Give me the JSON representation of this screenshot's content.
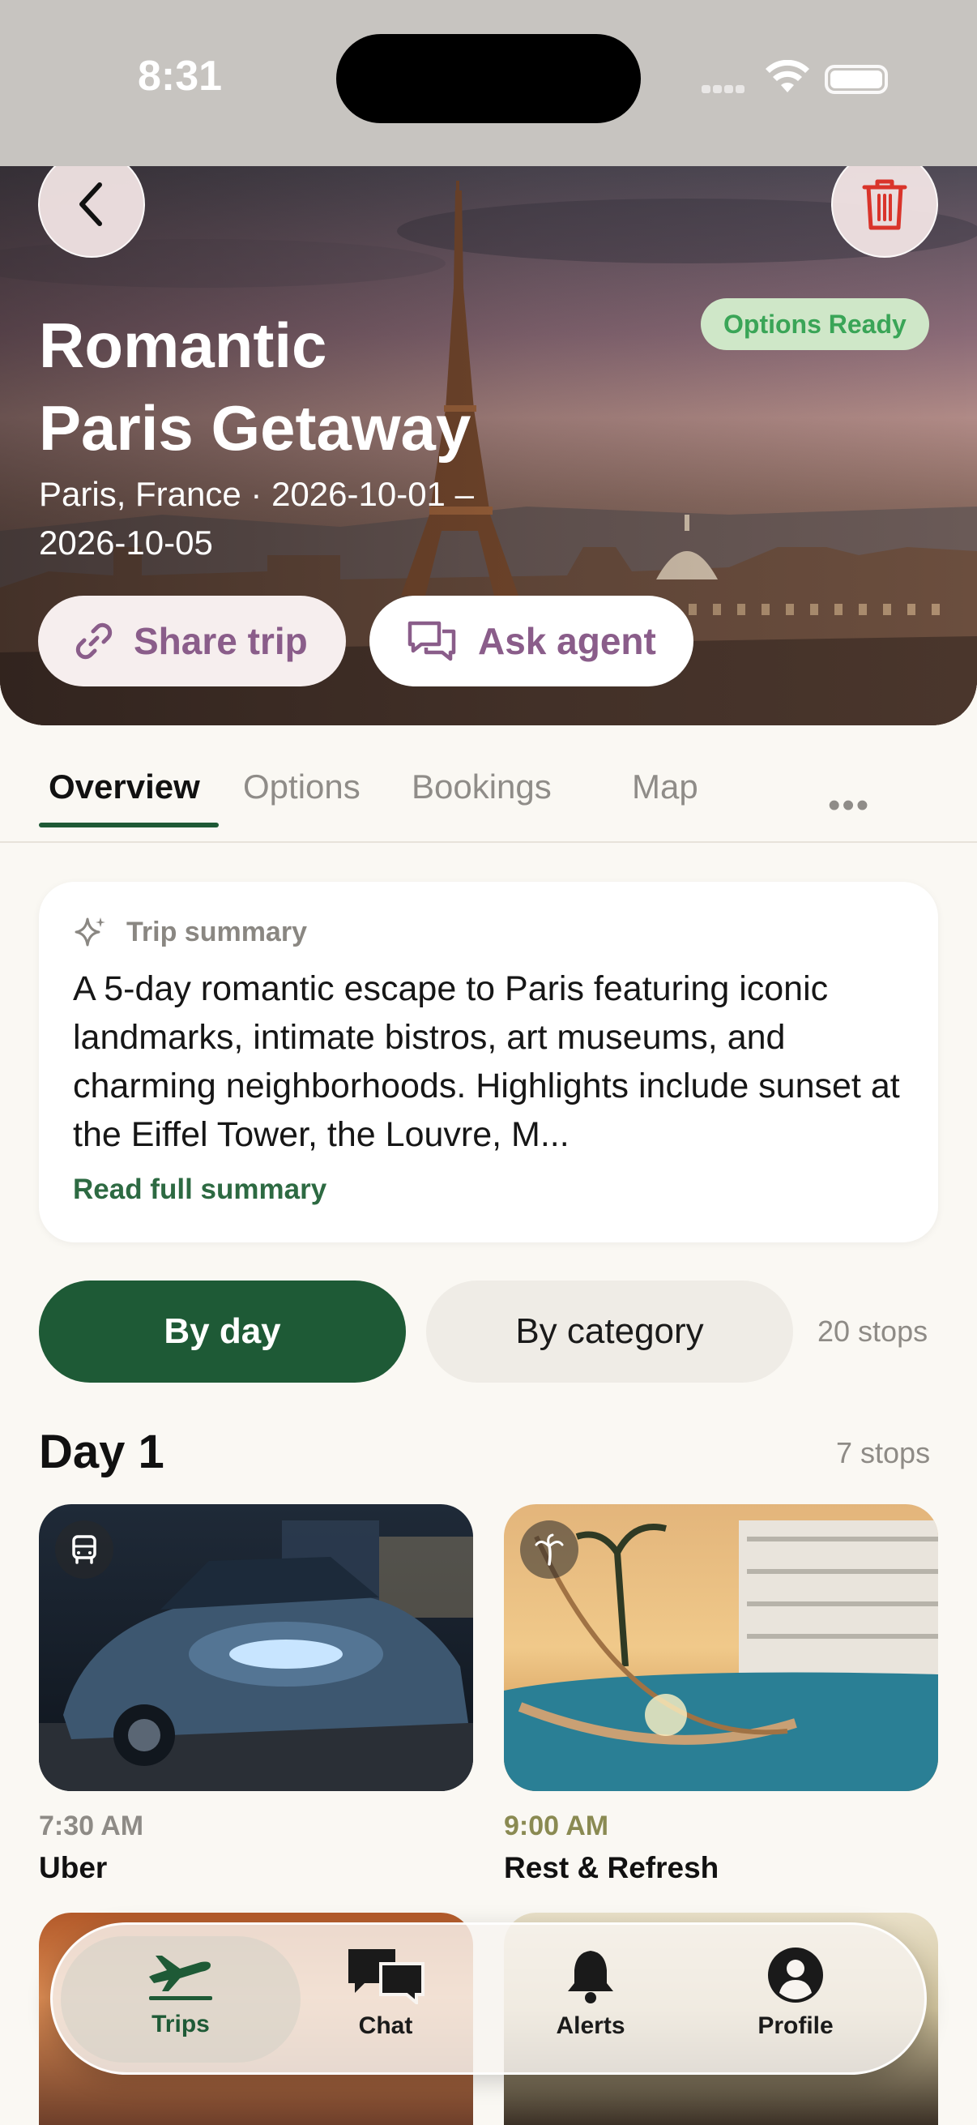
{
  "status_bar": {
    "time": "8:31"
  },
  "trip": {
    "title_line1": "Romantic",
    "title_line2": "Paris Getaway",
    "subtitle_line1": "Paris, France · 2026-10-01 –",
    "subtitle_line2": "2026-10-05",
    "status": "Options Ready"
  },
  "actions": {
    "share": "Share trip",
    "ask": "Ask agent"
  },
  "tabs": [
    "Overview",
    "Options",
    "Bookings",
    "Map"
  ],
  "summary": {
    "heading": "Trip summary",
    "text": "A 5-day romantic escape to Paris featuring iconic landmarks, intimate bistros, art museums, and charming neighborhoods. Highlights include sunset at the Eiffel Tower, the Louvre, M...",
    "read_more": "Read full summary"
  },
  "grouping": {
    "by_day": "By day",
    "by_category": "By category",
    "stops_total": "20 stops"
  },
  "day": {
    "title": "Day 1",
    "stops": "7 stops",
    "items": [
      {
        "time": "7:30 AM",
        "title": "Uber",
        "icon": "bus-icon",
        "time_color": "#8e8b86"
      },
      {
        "time": "9:00 AM",
        "title": "Rest & Refresh",
        "icon": "palm-icon",
        "time_color": "#8a8a52"
      }
    ]
  },
  "nav": {
    "trips": "Trips",
    "chat": "Chat",
    "alerts": "Alerts",
    "profile": "Profile"
  },
  "colors": {
    "accent": "#1e5a36",
    "purple": "#8a5d8a",
    "badge_bg": "#cfe7c8",
    "badge_text": "#3aa557",
    "danger": "#d9342b"
  }
}
